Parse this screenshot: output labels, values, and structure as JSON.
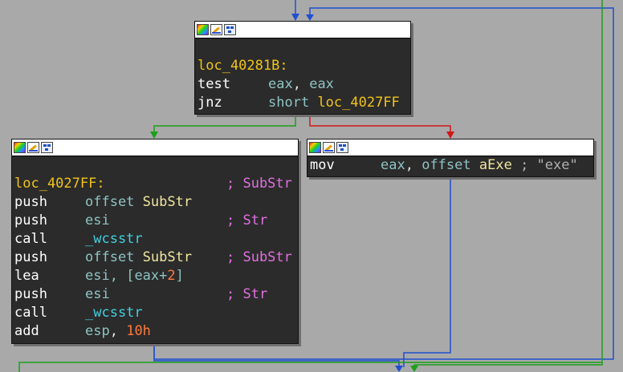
{
  "nodes": {
    "top": {
      "label": "loc_40281B:",
      "l1_mn": "test",
      "l1_a": "eax",
      "l1_s": ", ",
      "l1_b": "eax",
      "l2_mn": "jnz",
      "l2_kw": "short",
      "l2_sp": " ",
      "l2_t": "loc_4027FF"
    },
    "left": {
      "label": "loc_4027FF:",
      "label_comment": "; SubStr",
      "l1_mn": "push",
      "l1_kw": "offset",
      "l1_sp": " ",
      "l1_sym": "SubStr",
      "l2_mn": "push",
      "l2_reg": "esi",
      "l2_cm": "; Str",
      "l3_mn": "call",
      "l3_fn": "_wcsstr",
      "l4_mn": "push",
      "l4_kw": "offset",
      "l4_sp": " ",
      "l4_sym": "SubStr",
      "l4_cm": "; SubStr",
      "l5_mn": "lea",
      "l5_a": "esi",
      "l5_p1": ", [",
      "l5_r": "eax",
      "l5_plus": "+",
      "l5_n": "2",
      "l5_p2": "]",
      "l6_mn": "push",
      "l6_reg": "esi",
      "l6_cm": "; Str",
      "l7_mn": "call",
      "l7_fn": "_wcsstr",
      "l8_mn": "add",
      "l8_a": "esp",
      "l8_s": ", ",
      "l8_n": "10h"
    },
    "right": {
      "l1_mn": "mov",
      "l1_a": "eax",
      "l1_s": ", ",
      "l1_kw": "offset",
      "l1_sp": " ",
      "l1_sym": "aExe",
      "l1_cm": " ; ",
      "l1_str": "\"exe\""
    }
  },
  "edge_colors": {
    "true": "#1aa01a",
    "false": "#d01818",
    "normal": "#1f4fd0"
  }
}
